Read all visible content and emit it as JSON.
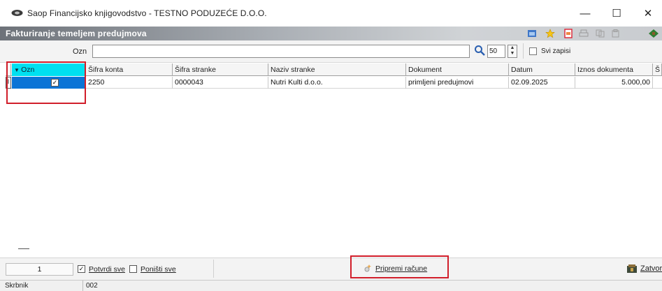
{
  "window": {
    "title": "Saop Financijsko knjigovodstvo - TESTNO PODUZEĆE D.O.O.",
    "minimize": "—",
    "maximize": "☐",
    "close": "✕"
  },
  "form": {
    "title": "Fakturiranje temeljem predujmova"
  },
  "filter": {
    "label": "Ozn",
    "value": "",
    "count": "50",
    "show_all_label": "Svi zapisi"
  },
  "grid": {
    "columns": [
      "Ozn",
      "Šifra konta",
      "Šifra stranke",
      "Naziv stranke",
      "Dokument",
      "Datum",
      "Iznos dokumenta",
      "Š"
    ],
    "rows": [
      {
        "ozn": true,
        "sifra_konta": "2250",
        "sifra_stranke": "0000043",
        "naziv_stranke": "Nutri Kulti d.o.o.",
        "dokument": "primljeni predujmovi",
        "datum": "02.09.2025",
        "iznos": "5.000,00"
      }
    ]
  },
  "bottom": {
    "page": "1",
    "confirm_all_label": "Potvrdi sve",
    "cancel_all_label": "Poništi sve",
    "prepare_label": "Pripremi račune",
    "close_label": "Zatvori"
  },
  "status": {
    "user": "Skrbnik",
    "code": "002"
  },
  "colors": {
    "selected_header": "#00e0f0",
    "selected_cell": "#0a74d6",
    "highlight": "#d11e2a"
  }
}
